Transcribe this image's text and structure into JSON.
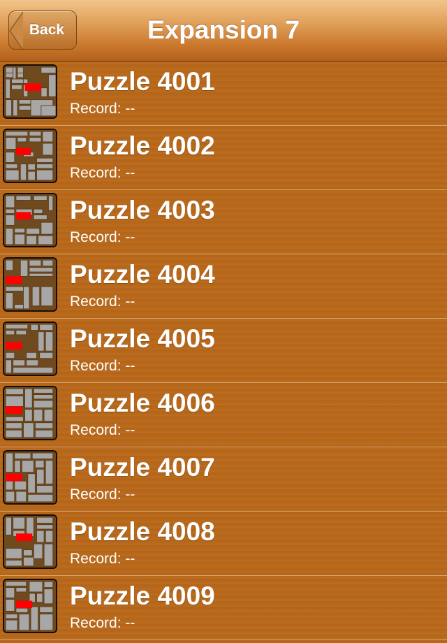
{
  "navbar": {
    "back_label": "Back",
    "title": "Expansion 7"
  },
  "record_prefix": "Record:",
  "colors": {
    "target_block": "#ff0000",
    "block": "#a7a7a7",
    "board": "#6e4a1e"
  },
  "puzzles": [
    {
      "title": "Puzzle 4001",
      "record": "Record: --"
    },
    {
      "title": "Puzzle 4002",
      "record": "Record: --"
    },
    {
      "title": "Puzzle 4003",
      "record": "Record: --"
    },
    {
      "title": "Puzzle 4004",
      "record": "Record: --"
    },
    {
      "title": "Puzzle 4005",
      "record": "Record: --"
    },
    {
      "title": "Puzzle 4006",
      "record": "Record: --"
    },
    {
      "title": "Puzzle 4007",
      "record": "Record: --"
    },
    {
      "title": "Puzzle 4008",
      "record": "Record: --"
    },
    {
      "title": "Puzzle 4009",
      "record": "Record: --"
    }
  ]
}
